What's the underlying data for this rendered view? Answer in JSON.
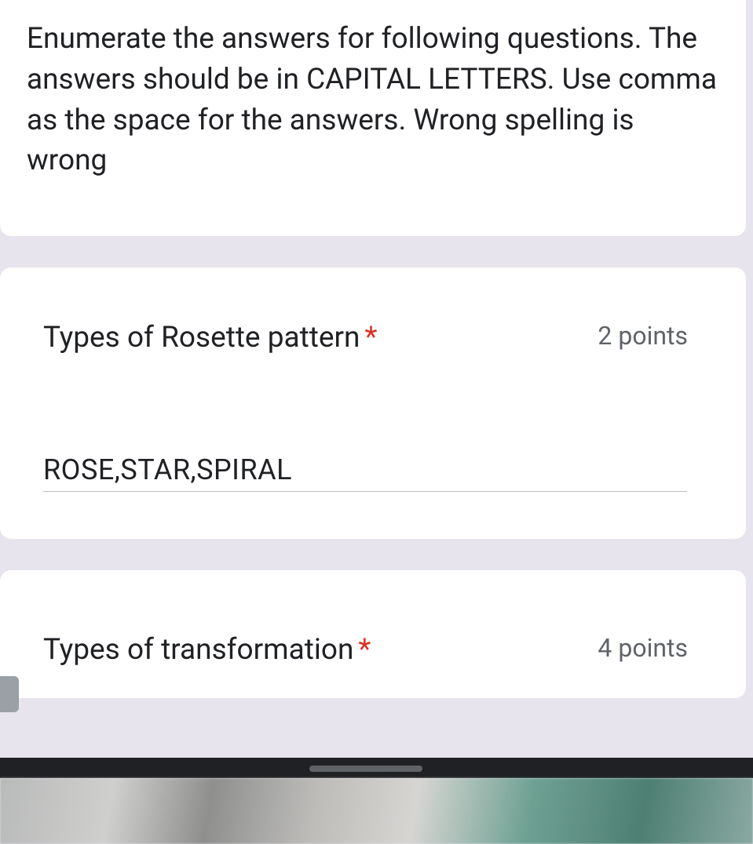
{
  "instructions": "Enumerate the answers for following questions. The answers should be in CAPITAL LETTERS. Use comma as the space for the answers. Wrong spelling is wrong",
  "questions": [
    {
      "title": "Types of Rosette pattern",
      "required_marker": "*",
      "points": "2 points",
      "answer": "ROSE,STAR,SPIRAL"
    },
    {
      "title": "Types of transformation",
      "required_marker": "*",
      "points": "4 points",
      "answer": ""
    }
  ]
}
